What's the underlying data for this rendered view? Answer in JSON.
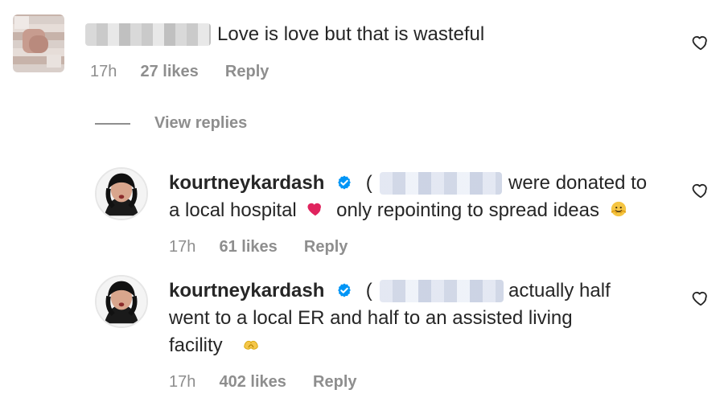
{
  "comment1": {
    "text": "Love is love but that is wasteful",
    "time": "17h",
    "likes": "27 likes",
    "reply": "Reply"
  },
  "thread": {
    "view_replies": "View replies"
  },
  "reply1": {
    "username": "kourtneykardash",
    "line1_prefix": "(",
    "line1_rest": "were donated to",
    "line2": "a local hospital",
    "line2_after_heart": "only repointing to spread ideas",
    "time": "17h",
    "likes": "61 likes",
    "reply": "Reply"
  },
  "reply2": {
    "username": "kourtneykardash",
    "line1_prefix": "(",
    "line1_rest": "actually half",
    "line2": "went to a local ER and half to an assisted living",
    "line3": "facility",
    "time": "17h",
    "likes": "402 likes",
    "reply": "Reply"
  },
  "icons": {
    "heart": "heart-outline-icon",
    "verified": "verified-badge-icon",
    "red_heart_emoji": "red-heart-emoji",
    "hugging_face_emoji": "hugging-face-emoji",
    "heart_hands_emoji": "heart-hands-emoji"
  },
  "colors": {
    "text": "#262626",
    "meta": "#8e8e8e",
    "verified": "#0095f6",
    "red_heart": "#e0245e",
    "emoji_yellow": "#f5c542"
  }
}
